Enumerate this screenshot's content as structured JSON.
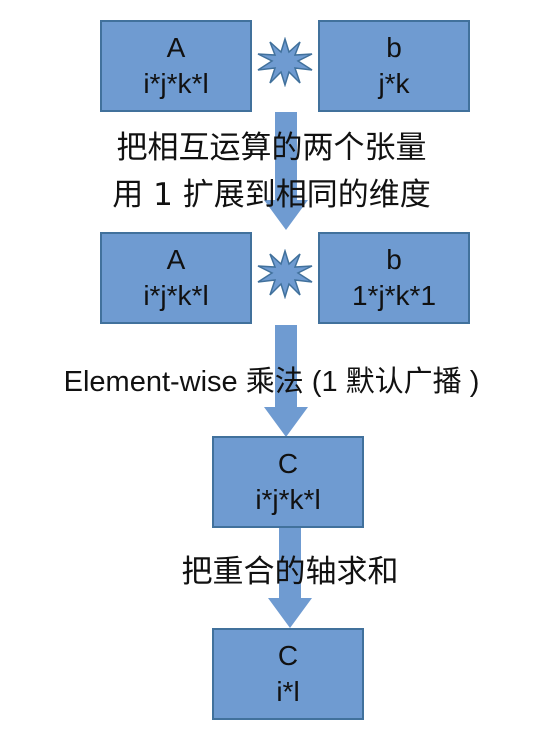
{
  "colors": {
    "box_fill": "#6f9bd1",
    "box_border": "#41719c",
    "arrow": "#6f9bd1",
    "star": "#6f9bd1",
    "text": "#111111"
  },
  "row1": {
    "left": {
      "title": "A",
      "shape": "i*j*k*l"
    },
    "right": {
      "title": "b",
      "shape": "j*k"
    }
  },
  "step1": {
    "line1": "把相互运算的两个张量",
    "line2": "用 1 扩展到相同的维度"
  },
  "row2": {
    "left": {
      "title": "A",
      "shape": "i*j*k*l"
    },
    "right": {
      "title": "b",
      "shape": "1*j*k*1"
    }
  },
  "step2": {
    "text": "Element-wise 乘法 (1 默认广播 )"
  },
  "row3": {
    "title": "C",
    "shape": "i*j*k*l"
  },
  "step3": {
    "text": "把重合的轴求和"
  },
  "row4": {
    "title": "C",
    "shape": "i*l"
  },
  "icons": {
    "multiply": "star-burst-icon",
    "flow": "down-arrow-icon"
  }
}
